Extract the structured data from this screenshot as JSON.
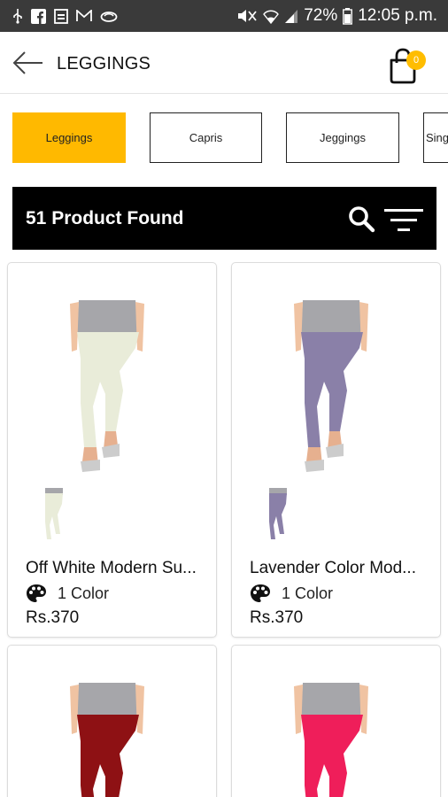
{
  "status_bar": {
    "battery": "72%",
    "time": "12:05 p.m.",
    "icons": [
      "usb-icon",
      "facebook-icon",
      "document-icon",
      "gmail-icon",
      "cloud-icon",
      "mute-icon",
      "wifi-icon",
      "signal-icon",
      "battery-icon"
    ]
  },
  "app_bar": {
    "title": "LEGGINGS",
    "cart_count": "0"
  },
  "categories": [
    {
      "label": "Leggings",
      "active": true
    },
    {
      "label": "Capris",
      "active": false
    },
    {
      "label": "Jeggings",
      "active": false
    },
    {
      "label": "Single",
      "active": false
    }
  ],
  "results": {
    "count_text": "51 Product Found"
  },
  "products": [
    {
      "name": "Off White Modern Su...",
      "colors": "1 Color",
      "price": "Rs.370",
      "color_hex": "#e9ecd9"
    },
    {
      "name": "Lavender Color Mod...",
      "colors": "1 Color",
      "price": "Rs.370",
      "color_hex": "#8a80a8"
    },
    {
      "name": "",
      "colors": "",
      "price": "",
      "color_hex": "#8e1114"
    },
    {
      "name": "",
      "colors": "",
      "price": "",
      "color_hex": "#ef1e5a"
    }
  ],
  "colors": {
    "accent": "#ffb900",
    "status_bar": "#3a3a3a",
    "result_bar": "#000000"
  }
}
